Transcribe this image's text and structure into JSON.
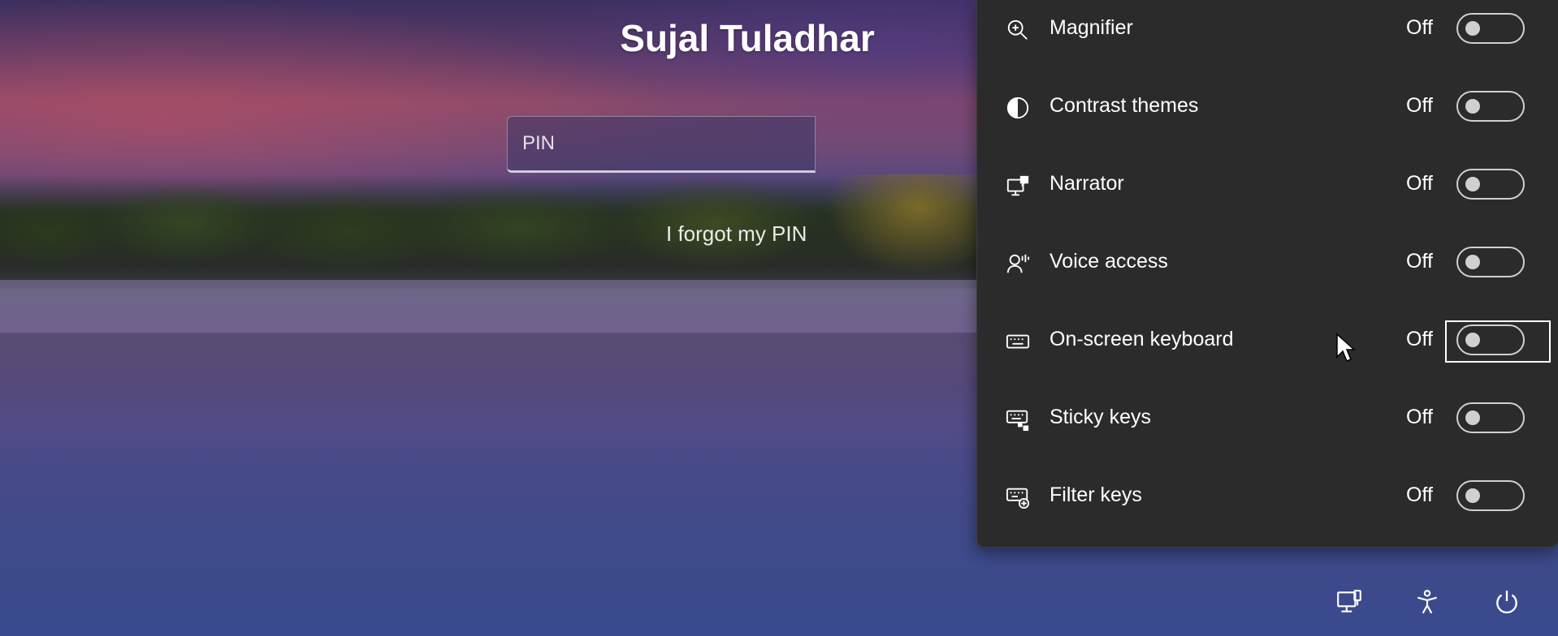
{
  "login": {
    "user_name": "Sujal Tuladhar",
    "pin_placeholder": "PIN",
    "pin_value": "",
    "forgot_link": "I forgot my PIN"
  },
  "accessibility_panel": {
    "items": [
      {
        "label": "Magnifier",
        "state": "Off",
        "icon": "magnifier-icon",
        "enabled": false
      },
      {
        "label": "Contrast themes",
        "state": "Off",
        "icon": "contrast-icon",
        "enabled": false
      },
      {
        "label": "Narrator",
        "state": "Off",
        "icon": "narrator-icon",
        "enabled": false
      },
      {
        "label": "Voice access",
        "state": "Off",
        "icon": "voice-access-icon",
        "enabled": false
      },
      {
        "label": "On-screen keyboard",
        "state": "Off",
        "icon": "keyboard-icon",
        "enabled": false
      },
      {
        "label": "Sticky keys",
        "state": "Off",
        "icon": "sticky-keys-icon",
        "enabled": false
      },
      {
        "label": "Filter keys",
        "state": "Off",
        "icon": "filter-keys-icon",
        "enabled": false
      }
    ],
    "focused_item": "On-screen keyboard"
  },
  "tray": {
    "icons": [
      "network-icon",
      "accessibility-icon",
      "power-icon"
    ]
  },
  "colors": {
    "panel_bg": "#2b2b2b",
    "text": "#ffffff",
    "toggle_outline": "#d0d0d0"
  }
}
